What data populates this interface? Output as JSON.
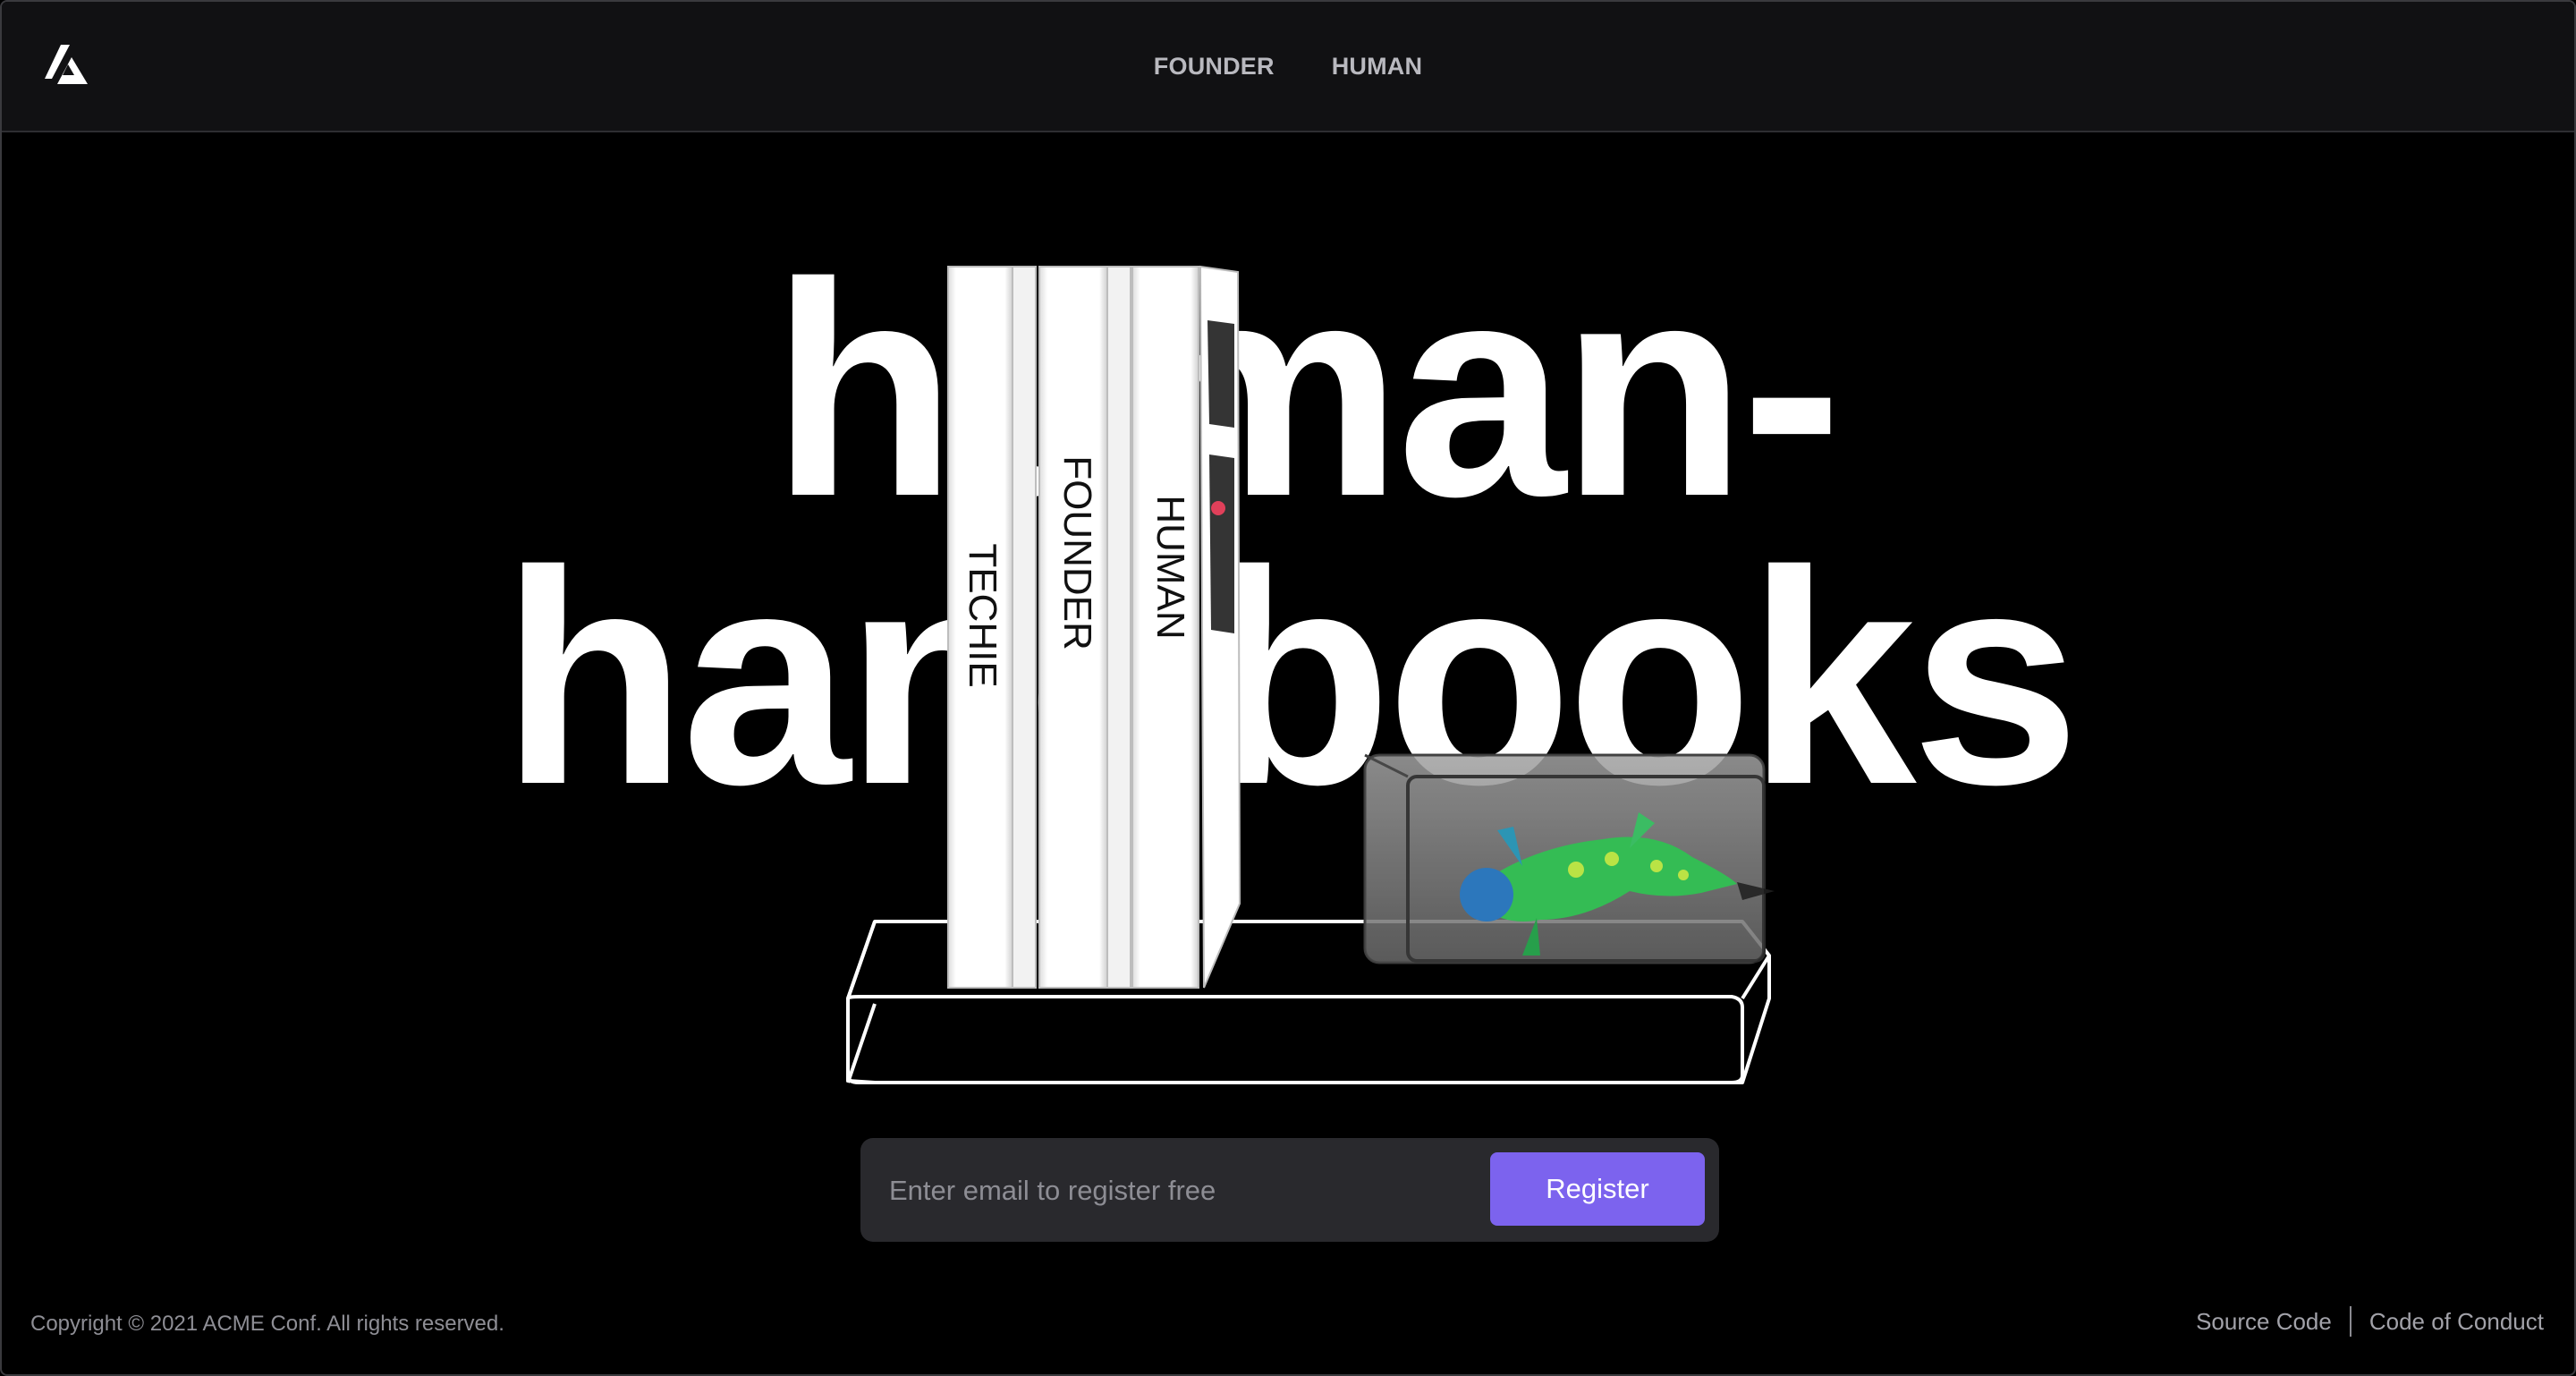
{
  "header": {
    "logo_icon": "triangle-logo-icon",
    "nav": [
      {
        "label": "FOUNDER"
      },
      {
        "label": "HUMAN"
      }
    ]
  },
  "hero": {
    "title_line_1": "human-",
    "title_line_2": "handbooks",
    "books": [
      {
        "spine": "TECHIE"
      },
      {
        "spine": "FOUNDER"
      },
      {
        "spine": "HUMAN"
      }
    ]
  },
  "register": {
    "placeholder": "Enter email to register free",
    "value": "",
    "button_label": "Register",
    "accent_color": "#7c63ee"
  },
  "footer": {
    "copyright": "Copyright © 2021 ACME Conf. All rights reserved.",
    "links": [
      {
        "label": "Source Code"
      },
      {
        "label": "Code of Conduct"
      }
    ]
  }
}
